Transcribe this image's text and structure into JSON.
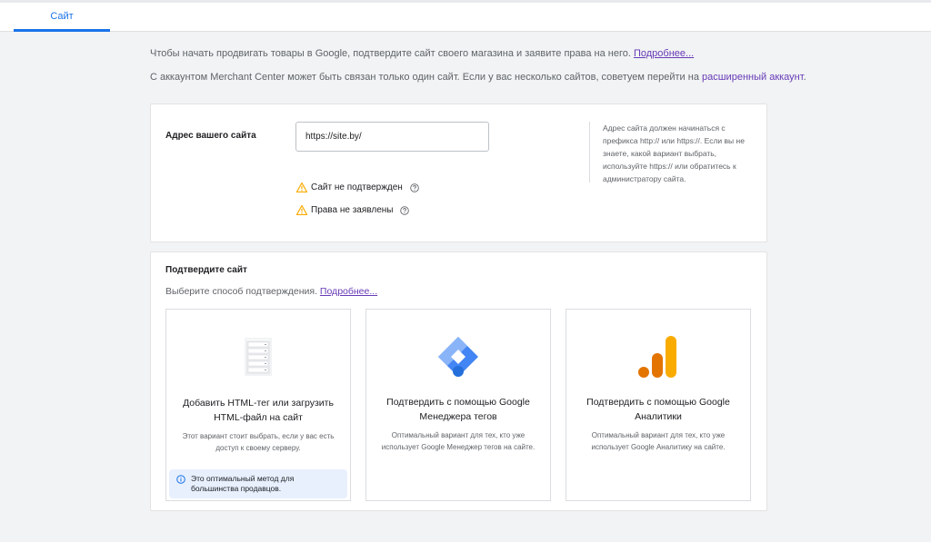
{
  "tabs": [
    {
      "label": "Сайт"
    }
  ],
  "intro": {
    "line1_text": "Чтобы начать продвигать товары в Google, подтвердите сайт своего магазина и заявите права на него.",
    "line1_link": "Подробнее...",
    "line2_text": "С аккаунтом Merchant Center может быть связан только один сайт. Если у вас несколько сайтов, советуем перейти на",
    "line2_link": "расширенный аккаунт",
    "line2_end": "."
  },
  "address_card": {
    "label": "Адрес вашего сайта",
    "input_value": "https://site.by/",
    "helper": "Адрес сайта должен начинаться с префикса http:// или https://. Если вы не знаете, какой вариант выбрать, используйте https:// или обратитесь к администратору сайта.",
    "statuses": [
      {
        "text": "Сайт не подтвержден",
        "icon": "warning-icon"
      },
      {
        "text": "Права не заявлены",
        "icon": "warning-icon"
      }
    ]
  },
  "confirm_card": {
    "title": "Подтвердите сайт",
    "choose_text": "Выберите способ подтверждения.",
    "choose_link": "Подробнее...",
    "options": [
      {
        "title": "Добавить HTML-тег или загрузить HTML-файл на сайт",
        "description": "Этот вариант стоит выбрать, если у вас есть доступ к своему серверу.",
        "icon": "html-file-icon",
        "recommendation": "Это оптимальный метод для большинства продавцов."
      },
      {
        "title": "Подтвердить с помощью Google Менеджера тегов",
        "description": "Оптимальный вариант для тех, кто уже использует Google Менеджер тегов на сайте.",
        "icon": "tag-manager-icon"
      },
      {
        "title": "Подтвердить с помощью Google Аналитики",
        "description": "Оптимальный вариант для тех, кто уже использует Google Аналитику на сайте.",
        "icon": "analytics-icon"
      }
    ]
  },
  "colors": {
    "accent": "#1a73e8",
    "link": "#673ab7",
    "warning": "#f9ab00",
    "analytics_orange": "#f9ab00",
    "analytics_dark": "#e37400"
  }
}
